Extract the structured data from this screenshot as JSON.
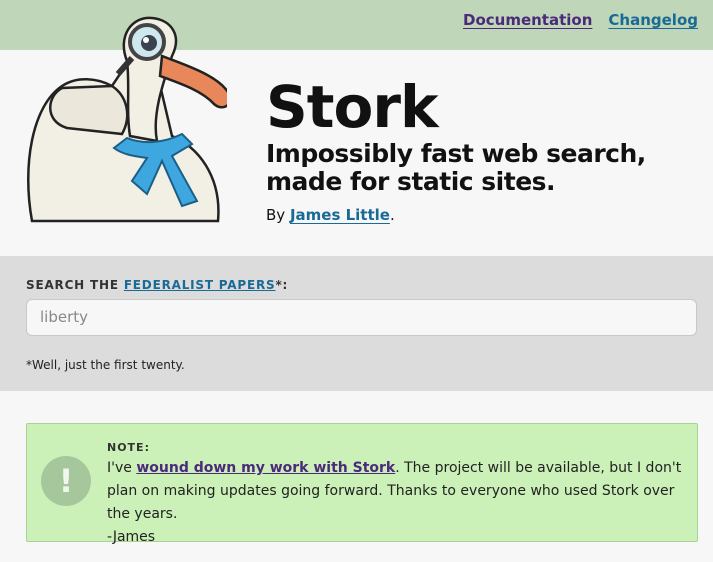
{
  "nav": {
    "documentation": "Documentation",
    "changelog": "Changelog"
  },
  "hero": {
    "title": "Stork",
    "tagline_line1": "Impossibly fast web search,",
    "tagline_line2": "made for static sites.",
    "by_prefix": "By ",
    "author": "James Little",
    "by_suffix": "."
  },
  "search": {
    "label_prefix": "SEARCH THE ",
    "label_link": "FEDERALIST PAPERS",
    "label_suffix": "*:",
    "value": "liberty",
    "footnote": "*Well, just the first twenty."
  },
  "note": {
    "icon": "exclamation-icon",
    "title": "NOTE:",
    "text_prefix": "I've ",
    "link": "wound down my work with Stork",
    "text_rest": ". The project will be available, but I don't plan on making updates going forward. Thanks to everyone who used Stork over the years.",
    "signature": "-James"
  },
  "colors": {
    "topbar": "#bfd6b9",
    "link": "#1a6a96",
    "visited": "#4b2a7a",
    "search_band": "#dcdcdc",
    "note_bg": "#cbf0b8"
  }
}
